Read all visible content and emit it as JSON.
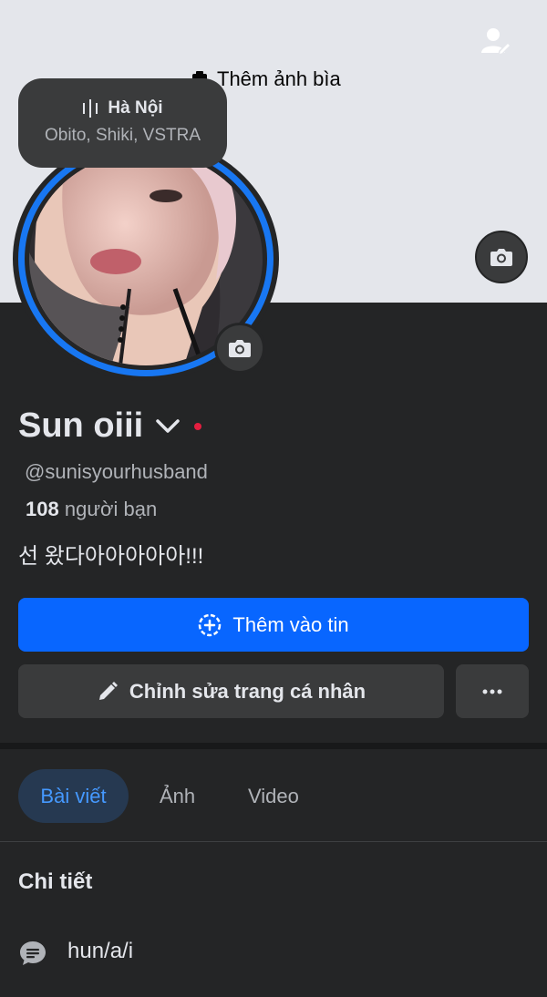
{
  "cover": {
    "add_cover_label": "Thêm ảnh bìa"
  },
  "location_bubble": {
    "city": "Hà Nội",
    "interests": "Obito, Shiki, VSTRA"
  },
  "profile": {
    "name": "Sun oiii",
    "handle": "@sunisyourhusband",
    "friends_count": "108",
    "friends_label": "người bạn",
    "bio": "선 왔다아아아아아!!!"
  },
  "actions": {
    "add_story_label": "Thêm vào tin",
    "edit_profile_label": "Chỉnh sửa trang cá nhân",
    "more_icon": "more-horizontal-icon"
  },
  "tabs": [
    {
      "label": "Bài viết",
      "active": true
    },
    {
      "label": "Ảnh",
      "active": false
    },
    {
      "label": "Video",
      "active": false
    }
  ],
  "details": {
    "title": "Chi tiết",
    "pronouns": "hun/a/i"
  },
  "colors": {
    "accent": "#0866ff",
    "background": "#242526",
    "cover": "#e4e6eb",
    "active_tab": "#263951",
    "status_dot": "#e41e3f"
  }
}
